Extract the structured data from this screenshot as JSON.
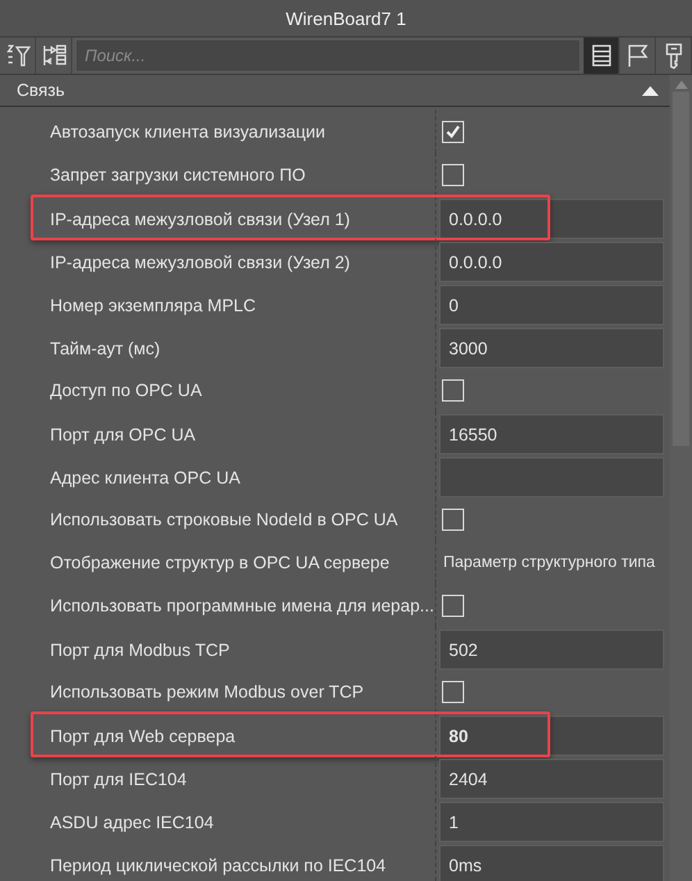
{
  "window": {
    "title": "WirenBoard7 1"
  },
  "search": {
    "placeholder": "Поиск..."
  },
  "view_buttons": [
    {
      "kind": "list",
      "selected": true
    },
    {
      "kind": "flag",
      "selected": false
    },
    {
      "kind": "key",
      "selected": false
    }
  ],
  "section": {
    "title": "Связь",
    "expanded": true
  },
  "rows": [
    {
      "label": "Автозапуск клиента визуализации",
      "kind": "checkbox",
      "checked": true,
      "highlighted": false
    },
    {
      "label": "Запрет загрузки системного ПО",
      "kind": "checkbox",
      "checked": false,
      "highlighted": false
    },
    {
      "label": "IP-адреса межузловой связи (Узел 1)",
      "kind": "field",
      "value": "0.0.0.0",
      "modified": false,
      "highlighted": true
    },
    {
      "label": "IP-адреса межузловой связи (Узел 2)",
      "kind": "field",
      "value": "0.0.0.0",
      "modified": false,
      "highlighted": false
    },
    {
      "label": "Номер экземпляра MPLC",
      "kind": "field",
      "value": "0",
      "modified": false,
      "highlighted": false
    },
    {
      "label": "Тайм-аут (мс)",
      "kind": "field",
      "value": "3000",
      "modified": false,
      "highlighted": false
    },
    {
      "label": "Доступ по OPC UA",
      "kind": "checkbox",
      "checked": false,
      "highlighted": false
    },
    {
      "label": "Порт для OPC UA",
      "kind": "field",
      "value": "16550",
      "modified": false,
      "highlighted": false
    },
    {
      "label": "Адрес клиента OPC UA",
      "kind": "field",
      "highlighted": false
    },
    {
      "label": "Использовать строковые NodeId в OPC UA",
      "kind": "checkbox",
      "checked": false,
      "highlighted": false
    },
    {
      "label": "Отображение структур в OPC UA сервере",
      "kind": "text",
      "value": "Параметр структурного типа",
      "highlighted": false
    },
    {
      "label": "Использовать программные имена для иерар...",
      "kind": "checkbox",
      "checked": false,
      "highlighted": false
    },
    {
      "label": "Порт для Modbus TCP",
      "kind": "field",
      "value": "502",
      "modified": false,
      "highlighted": false
    },
    {
      "label": "Использовать режим Modbus over TCP",
      "kind": "checkbox",
      "checked": false,
      "highlighted": false
    },
    {
      "label": "Порт для Web сервера",
      "kind": "field",
      "value": "80",
      "modified": true,
      "highlighted": true
    },
    {
      "label": "Порт для IEC104",
      "kind": "field",
      "value": "2404",
      "modified": false,
      "highlighted": false
    },
    {
      "label": "ASDU адрес IEC104",
      "kind": "field",
      "value": "1",
      "modified": false,
      "highlighted": false
    },
    {
      "label": "Период циклической рассылки по IEC104",
      "kind": "field",
      "value": "0ms",
      "modified": false,
      "highlighted": false
    }
  ]
}
